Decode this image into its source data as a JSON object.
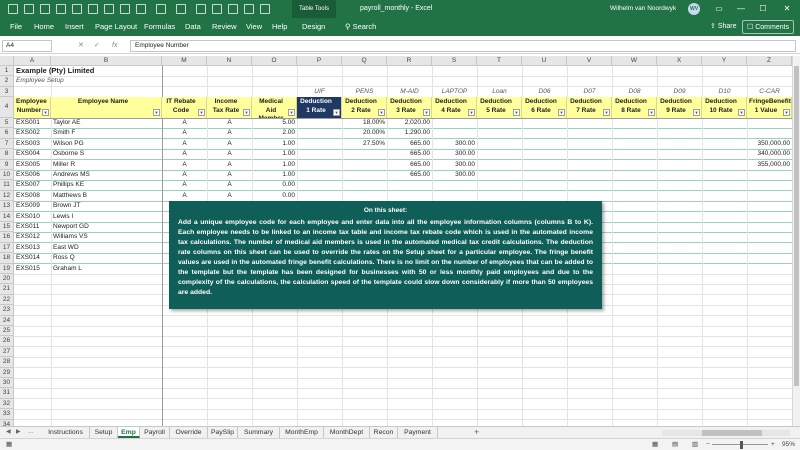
{
  "window": {
    "title": "payroll_monthly  -  Excel",
    "table_tools": "Table Tools",
    "user_name": "Wilhelm van Noordwyk",
    "user_initials": "WV",
    "controls": {
      "ribbon_display": "▭",
      "minimize": "—",
      "maximize": "☐",
      "close": "✕"
    }
  },
  "ribbon": {
    "tabs": [
      "File",
      "Home",
      "Insert",
      "Page Layout",
      "Formulas",
      "Data",
      "Review",
      "View",
      "Help",
      "Design"
    ],
    "search_label": "Search",
    "share_label": "Share",
    "comments_label": "Comments"
  },
  "formula_bar": {
    "name_box": "A4",
    "cancel": "✕",
    "enter": "✓",
    "fx": "fx",
    "content": "Employee Number"
  },
  "columns": [
    "A",
    "B",
    "M",
    "N",
    "O",
    "P",
    "Q",
    "R",
    "S",
    "T",
    "U",
    "V",
    "W",
    "X",
    "Y",
    "Z"
  ],
  "rows": [
    "1",
    "2",
    "3",
    "4",
    "5",
    "6",
    "7",
    "8",
    "9",
    "10",
    "11",
    "12",
    "13",
    "14",
    "15",
    "16",
    "17",
    "18",
    "19",
    "20",
    "21",
    "22",
    "23",
    "24",
    "25",
    "26",
    "27",
    "28",
    "29",
    "30",
    "31",
    "32",
    "33",
    "34",
    "35"
  ],
  "sheet": {
    "company": "Example (Pty) Limited",
    "subtitle": "Employee Setup",
    "row3_codes": [
      "",
      "",
      "",
      "",
      "",
      "UIF",
      "PENS",
      "M-AID",
      "LAPTOP",
      "Loan",
      "D06",
      "D07",
      "D08",
      "D09",
      "D10",
      "C-CAR"
    ],
    "headers": [
      "Employee Number",
      "Employee Name",
      "IT Rebate Code",
      "Income Tax Rate",
      "Medical Aid Member",
      "Deduction 1 Rate",
      "Deduction 2 Rate",
      "Deduction 3 Rate",
      "Deduction 4 Rate",
      "Deduction 5 Rate",
      "Deduction 6 Rate",
      "Deduction 7 Rate",
      "Deduction 8 Rate",
      "Deduction 9 Rate",
      "Deduction 10 Rate",
      "FringeBenefit 1 Value"
    ],
    "employees": [
      {
        "num": "EXS001",
        "name": "Taylor AE",
        "rebate": "A",
        "tax": "A",
        "med": "5.00",
        "d1": "",
        "d2": "18.00%",
        "d3": "2,020.00",
        "d4": "",
        "fringe": ""
      },
      {
        "num": "EXS002",
        "name": "Smith F",
        "rebate": "A",
        "tax": "A",
        "med": "2.00",
        "d1": "",
        "d2": "20.00%",
        "d3": "1,290.00",
        "d4": "",
        "fringe": ""
      },
      {
        "num": "EXS003",
        "name": "Wilson PG",
        "rebate": "A",
        "tax": "A",
        "med": "1.00",
        "d1": "",
        "d2": "27.50%",
        "d3": "665.00",
        "d4": "300.00",
        "fringe": "350,000.00"
      },
      {
        "num": "EXS004",
        "name": "Osborne S",
        "rebate": "A",
        "tax": "A",
        "med": "1.00",
        "d1": "",
        "d2": "",
        "d3": "665.00",
        "d4": "300.00",
        "fringe": "340,000.00"
      },
      {
        "num": "EXS005",
        "name": "Miller R",
        "rebate": "A",
        "tax": "A",
        "med": "1.00",
        "d1": "",
        "d2": "",
        "d3": "665.00",
        "d4": "300.00",
        "fringe": "355,000.00"
      },
      {
        "num": "EXS006",
        "name": "Andrews MS",
        "rebate": "A",
        "tax": "A",
        "med": "1.00",
        "d1": "",
        "d2": "",
        "d3": "665.00",
        "d4": "300.00",
        "fringe": ""
      },
      {
        "num": "EXS007",
        "name": "Phillips KE",
        "rebate": "A",
        "tax": "A",
        "med": "0.00",
        "d1": "",
        "d2": "",
        "d3": "",
        "d4": "",
        "fringe": ""
      },
      {
        "num": "EXS008",
        "name": "Matthews B",
        "rebate": "A",
        "tax": "A",
        "med": "0.00",
        "d1": "",
        "d2": "",
        "d3": "",
        "d4": "",
        "fringe": ""
      },
      {
        "num": "EXS009",
        "name": "Brown JT",
        "rebate": "",
        "tax": "",
        "med": "",
        "d1": "",
        "d2": "",
        "d3": "",
        "d4": "",
        "fringe": ""
      },
      {
        "num": "EXS010",
        "name": "Lewis I",
        "rebate": "",
        "tax": "",
        "med": "",
        "d1": "",
        "d2": "",
        "d3": "",
        "d4": "",
        "fringe": ""
      },
      {
        "num": "EXS011",
        "name": "Newport GD",
        "rebate": "",
        "tax": "",
        "med": "",
        "d1": "",
        "d2": "",
        "d3": "",
        "d4": "",
        "fringe": ""
      },
      {
        "num": "EXS012",
        "name": "Williams VS",
        "rebate": "",
        "tax": "",
        "med": "",
        "d1": "",
        "d2": "",
        "d3": "",
        "d4": "",
        "fringe": ""
      },
      {
        "num": "EXS013",
        "name": "East WD",
        "rebate": "",
        "tax": "",
        "med": "",
        "d1": "",
        "d2": "",
        "d3": "",
        "d4": "",
        "fringe": ""
      },
      {
        "num": "EXS014",
        "name": "Ross Q",
        "rebate": "",
        "tax": "",
        "med": "",
        "d1": "",
        "d2": "",
        "d3": "",
        "d4": "",
        "fringe": ""
      },
      {
        "num": "EXS015",
        "name": "Graham L",
        "rebate": "",
        "tax": "",
        "med": "",
        "d1": "",
        "d2": "",
        "d3": "",
        "d4": "",
        "fringe": ""
      }
    ]
  },
  "note": {
    "title": "On this sheet:",
    "body": "Add a unique employee code for each employee and enter data into all the employee information columns (columns B to K). Each employee needs to be linked to an income tax table and income tax rebate code which is used in the automated income tax calculations. The number of medical aid members is used in the automated medical tax credit calculations. The deduction rate columns on this sheet can be used to override the rates on the Setup sheet for a particular employee. The fringe benefit values are used in the automated fringe benefit calculations. There is no limit on the number of employees that can be added to the template but the template has been designed for businesses with 50 or less monthly paid employees and due to the complexity of the calculations, the calculation speed of the template could slow down considerably if more than 50 employees are added."
  },
  "sheet_tabs": [
    "Instructions",
    "Setup",
    "Emp",
    "Payroll",
    "Override",
    "PaySlip",
    "Summary",
    "MonthEmp",
    "MonthDept",
    "Recon",
    "Payment"
  ],
  "active_tab": "Emp",
  "status": {
    "zoom": "95%",
    "add_sheet": "+",
    "nav_prev": "◀",
    "nav_next": "▶",
    "more": "..."
  },
  "colors": {
    "excel_green": "#217346",
    "header_yellow": "#ffff9c",
    "header_blue": "#1f3864",
    "note_teal": "#0f5e58"
  }
}
